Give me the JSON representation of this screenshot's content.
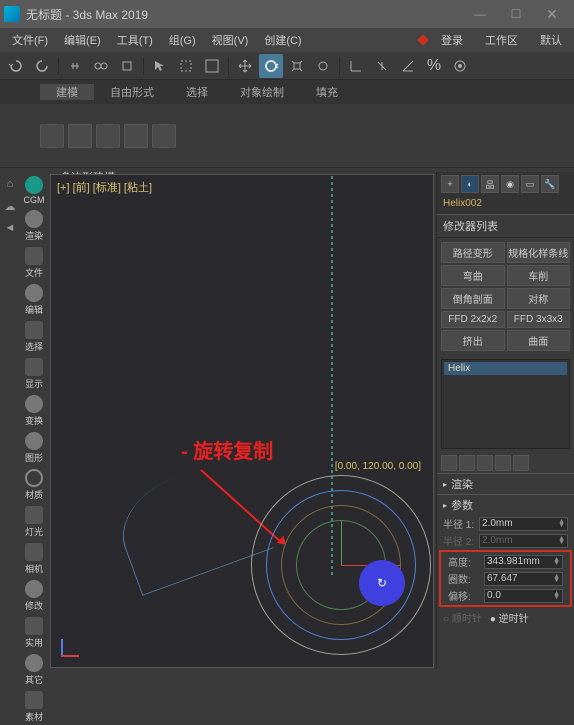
{
  "window": {
    "title": "无标题 - 3ds Max 2019"
  },
  "menu": {
    "file": "文件(F)",
    "edit": "编辑(E)",
    "tools": "工具(T)",
    "group": "组(G)",
    "views": "视图(V)",
    "create": "创建(C)",
    "login": "登录",
    "workspace": "工作区",
    "defaults": "默认"
  },
  "tabs": {
    "modeling": "建模",
    "freeform": "自由形式",
    "selection": "选择",
    "object_paint": "对象绘制",
    "populate": "填充"
  },
  "subtab": {
    "poly_model": "多边形建模"
  },
  "viewport": {
    "label": "[+] [前] [标准] [粘土]",
    "rotation_coords": "[0.00, 120.00, 0.00]"
  },
  "annotation": {
    "text": "旋转复制"
  },
  "sidebar": {
    "items": [
      {
        "label": "CGM"
      },
      {
        "label": "渲染"
      },
      {
        "label": "文件"
      },
      {
        "label": "编辑"
      },
      {
        "label": "选择"
      },
      {
        "label": "显示"
      },
      {
        "label": "变换"
      },
      {
        "label": "图形"
      },
      {
        "label": "材质"
      },
      {
        "label": "灯光"
      },
      {
        "label": "相机"
      },
      {
        "label": "修改"
      },
      {
        "label": "实用"
      },
      {
        "label": "其它"
      },
      {
        "label": "素材"
      }
    ]
  },
  "panel": {
    "object_name": "Helix002",
    "modifier_list_label": "修改器列表",
    "buttons": {
      "path_deform": "路径变形",
      "normalize_spline": "规格化样条线",
      "bend": "弯曲",
      "lathe": "车削",
      "chamfer": "倒角剖面",
      "symmetry": "对称",
      "ffd2": "FFD 2x2x2",
      "ffd3": "FFD 3x3x3",
      "extrude": "挤出",
      "surface": "曲面"
    },
    "stack_selected": "Helix",
    "rollout_render": "渲染",
    "rollout_params": "参数",
    "params": {
      "radius1_label": "半径 1:",
      "radius1_value": "2.0mm",
      "radius2_label": "半径 2:",
      "radius2_value": "2.0mm",
      "height_label": "高度:",
      "height_value": "343.981mm",
      "turns_label": "圈数:",
      "turns_value": "67.647",
      "bias_label": "偏移:",
      "bias_value": "0.0"
    },
    "radio": {
      "cw": "顺时针",
      "ccw": "逆时针"
    }
  }
}
